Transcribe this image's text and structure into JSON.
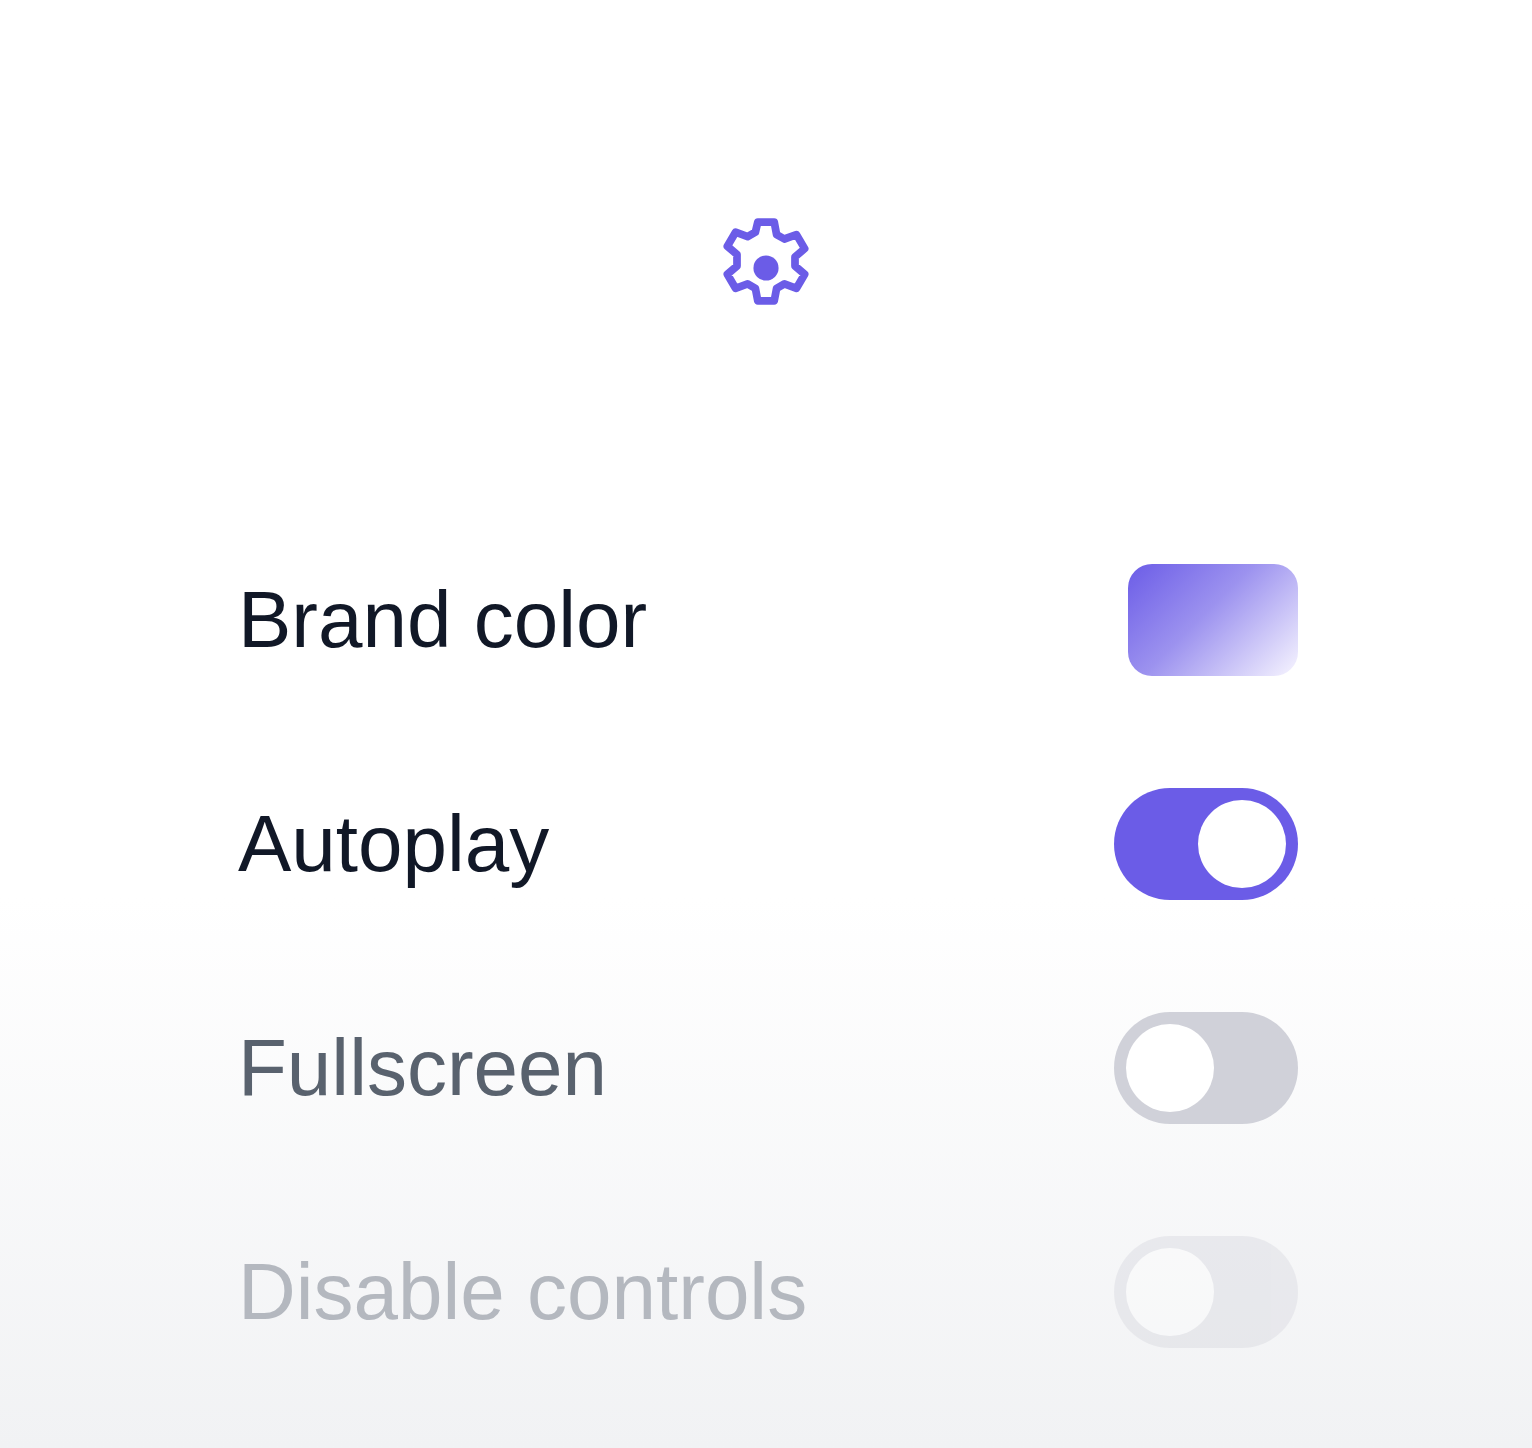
{
  "rows": [
    {
      "kind": "color",
      "label": "Brand color",
      "color": "#6b5ce7"
    },
    {
      "kind": "toggle",
      "label": "Autoplay",
      "on": true,
      "disabled": false
    },
    {
      "kind": "toggle",
      "label": "Fullscreen",
      "on": false,
      "disabled": false
    },
    {
      "kind": "toggle",
      "label": "Disable controls",
      "on": false,
      "disabled": true
    }
  ]
}
